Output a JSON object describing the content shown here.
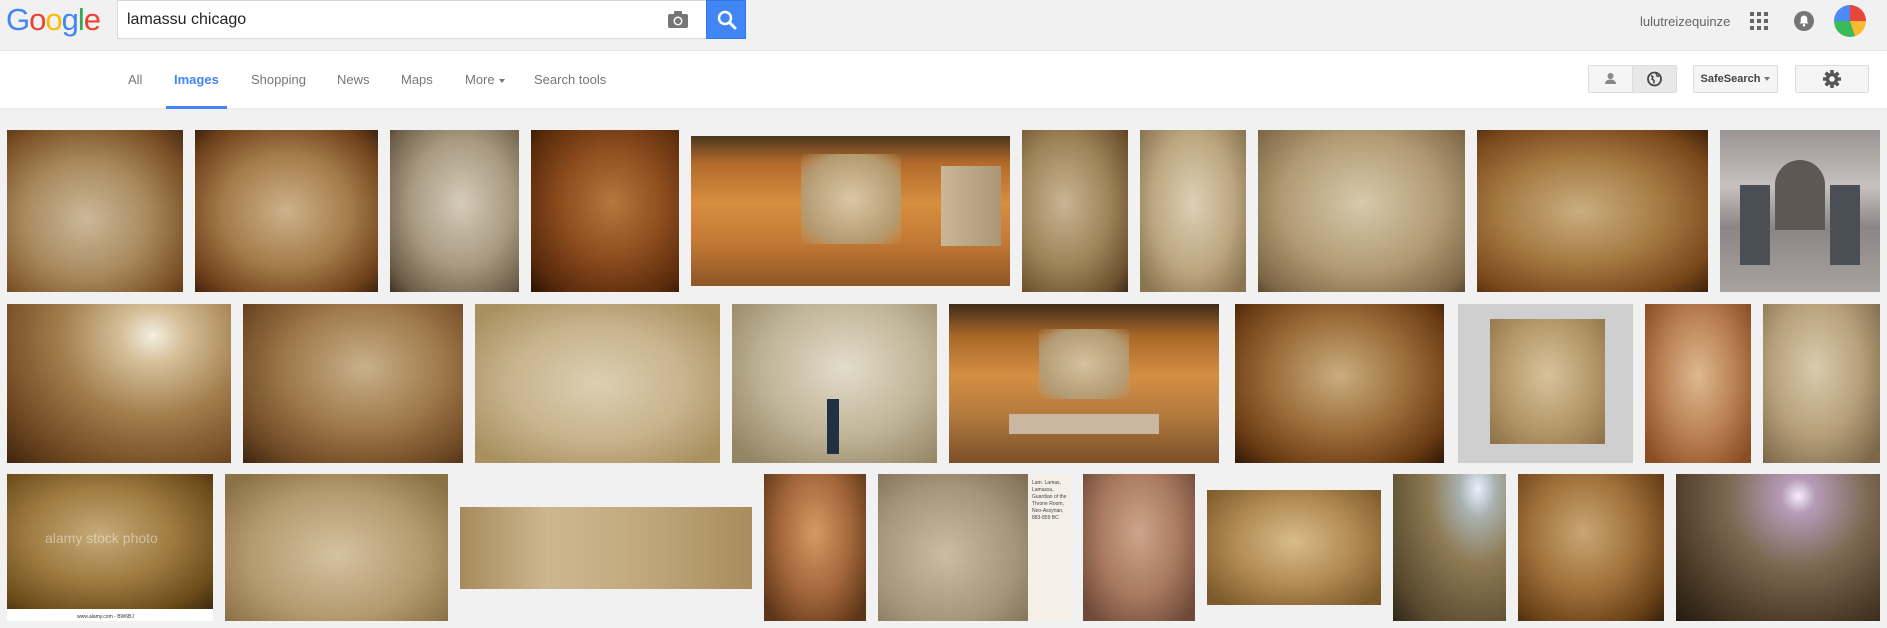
{
  "header": {
    "logo_letters": [
      {
        "ch": "G",
        "color": "#4285f4"
      },
      {
        "ch": "o",
        "color": "#ea4335"
      },
      {
        "ch": "o",
        "color": "#fbbc05"
      },
      {
        "ch": "g",
        "color": "#4285f4"
      },
      {
        "ch": "l",
        "color": "#34a853"
      },
      {
        "ch": "e",
        "color": "#ea4335"
      }
    ],
    "search_query": "lamassu chicago",
    "username": "lulutreizequinze",
    "icons": [
      "camera-icon",
      "search-icon",
      "apps-grid-icon",
      "notification-bell-icon"
    ]
  },
  "nav": {
    "tabs": [
      {
        "label": "All",
        "active": false
      },
      {
        "label": "Images",
        "active": true
      },
      {
        "label": "Shopping",
        "active": false
      },
      {
        "label": "News",
        "active": false
      },
      {
        "label": "Maps",
        "active": false
      },
      {
        "label": "More",
        "active": false
      },
      {
        "label": "Search tools",
        "active": false
      }
    ],
    "safesearch_label": "SafeSearch",
    "icons": [
      "person-icon",
      "globe-icon",
      "gear-icon"
    ]
  },
  "results": {
    "watermark_text": "alamy stock photo",
    "watermark_caption": "www.alamy.com - BW6BJ",
    "sign_text": "Lam. Lamas, Lamassu, Guardian of the Throne Room, Neo-Assyrian, 883-859 BC"
  },
  "colors": {
    "accent": "#4285f4",
    "background": "#f1f1f1"
  }
}
